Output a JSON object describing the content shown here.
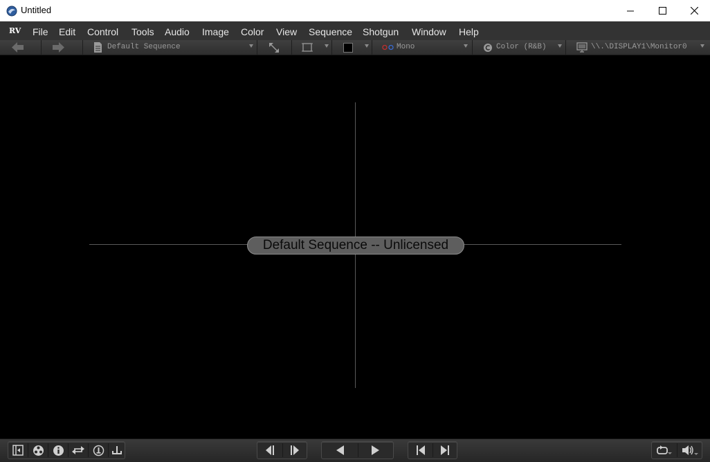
{
  "window": {
    "title": "Untitled",
    "controls": [
      "minimize-icon",
      "maximize-icon",
      "close-icon"
    ]
  },
  "menubar": {
    "logo": "RV",
    "items": [
      "File",
      "Edit",
      "Control",
      "Tools",
      "Audio",
      "Image",
      "Color",
      "View",
      "Sequence",
      "Shotgun",
      "Window",
      "Help"
    ]
  },
  "toolbar": {
    "back_icon": "arrow-left-icon",
    "forward_icon": "arrow-right-icon",
    "source_label": "Default Sequence",
    "stereo_label": "Mono",
    "color_label": "Color (R&B)",
    "display_label": "\\\\.\\DISPLAY1\\Monitor0"
  },
  "viewport": {
    "overlay_text": "Default Sequence -- Unlicensed"
  },
  "bottombar": {
    "left_icons": [
      "session-manager-icon",
      "color-wheel-icon",
      "info-icon",
      "swap-icon",
      "timecode-icon",
      "marker-icon"
    ],
    "step_icons": [
      "step-back-icon",
      "step-forward-icon"
    ],
    "play_icons": [
      "play-backward-icon",
      "play-forward-icon"
    ],
    "jump_icons": [
      "jump-start-icon",
      "jump-end-icon"
    ],
    "right_icons": [
      "loop-icon",
      "volume-icon"
    ]
  },
  "colors": {
    "background": "#000000",
    "menubar": "#333333",
    "overlay_pill": "#5e5e5e",
    "crosshair": "#5a5a5a"
  }
}
